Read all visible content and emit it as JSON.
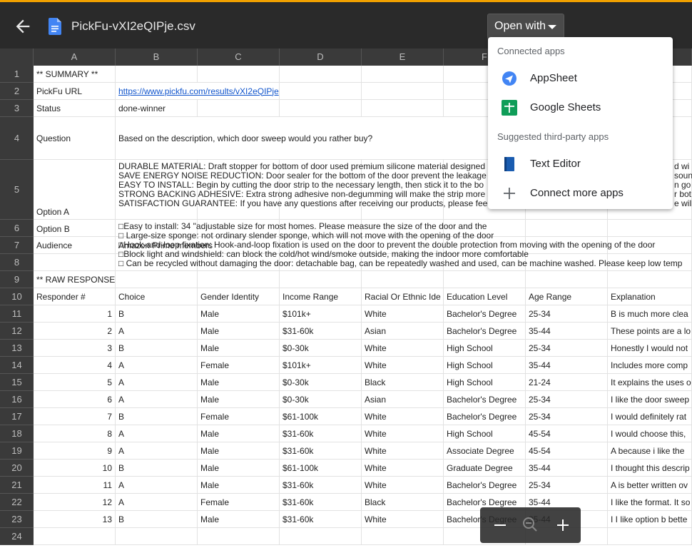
{
  "header": {
    "file_name": "PickFu-vXI2eQIPje.csv",
    "open_with_label": "Open with"
  },
  "icons": {
    "back": "arrow-left-icon",
    "file": "google-docs-file-icon",
    "appsheet": "appsheet-icon",
    "sheets": "google-sheets-icon",
    "text_editor": "text-editor-icon",
    "connect": "plus-icon",
    "zoom_out": "zoom-out-icon",
    "zoom_in": "zoom-in-icon"
  },
  "colors": {
    "topbar": "#2a2a2a",
    "accent": "#f0a000",
    "link": "#1155cc",
    "sheets_green": "#0f9d58",
    "appsheet_blue": "#4285f4"
  },
  "open_with_menu": {
    "connected_label": "Connected apps",
    "suggested_label": "Suggested third-party apps",
    "items": [
      {
        "label": "AppSheet"
      },
      {
        "label": "Google Sheets"
      },
      {
        "label": "Text Editor"
      },
      {
        "label": "Connect more apps"
      }
    ]
  },
  "sheet": {
    "columns": [
      "A",
      "B",
      "C",
      "D",
      "E",
      "F"
    ],
    "row_numbers": [
      "1",
      "2",
      "3",
      "4",
      "5",
      "6",
      "7",
      "8",
      "9",
      "10",
      "11",
      "12",
      "13",
      "14",
      "15",
      "16",
      "17",
      "18",
      "19",
      "20",
      "21",
      "22",
      "23",
      "24"
    ],
    "summary": {
      "r1": "** SUMMARY **",
      "r2_label": "PickFu URL",
      "r2_value": "https://www.pickfu.com/results/vXI2eQIPje",
      "r3_label": "Status",
      "r3_value": "done-winner",
      "r4_label": "Question",
      "r4_value": "Based on the description, which door sweep would you rather buy?",
      "r5_label": "Option A",
      "r5_value": "DURABLE MATERIAL: Draft stopper for bottom of door used premium silicone material designed\nSAVE ENERGY NOISE REDUCTION: Door sealer for the bottom of the door prevent the leakage o\nEASY TO INSTALL: Begin by cutting the door strip to the necessary length, then stick it to the bo\nSTRONG BACKING ADHESIVE: Extra strong adhesive non-degumming will make the strip more s\nSATISFACTION GUARANTEE: If you have any questions after receiving our products, please fee",
      "r5_right": "d wi\nsoun\nn go\nr bot\ne will",
      "r6_label": "Option B",
      "r6_value": "□Easy to install: 34 \"adjustable size for most homes. Please measure the size of the door and the\n□ Large-size sponge: not ordinary slender sponge, which will not move with the opening of the door\n□Hook-and-loop fixation: Hook-and-loop fixation is used on the door to prevent the double protection from moving with the opening of the door\n□Block light and windshield: can block the cold/hot wind/smoke outside, making the indoor more comfortable\n□ Can be recycled without damaging the door: detachable bag, can be repeatedly washed and used, can be machine washed. Please keep low temp",
      "r7_label": "Audience",
      "r7_value": "Amazon Prime members",
      "r9": "** RAW RESPONSES **"
    },
    "table_headers": [
      "Responder #",
      "Choice",
      "Gender Identity",
      "Income Range",
      "Racial Or Ethnic Ide",
      "Education Level",
      "Age Range",
      "Explanation"
    ],
    "rows": [
      [
        "1",
        "B",
        "Male",
        "$101k+",
        "White",
        "Bachelor's Degree",
        "25-34",
        "B is much more clea"
      ],
      [
        "2",
        "A",
        "Male",
        "$31-60k",
        "Asian",
        "Bachelor's Degree",
        "35-44",
        "These points are a lo"
      ],
      [
        "3",
        "B",
        "Male",
        "$0-30k",
        "White",
        "High School",
        "25-34",
        "Honestly I would not"
      ],
      [
        "4",
        "A",
        "Female",
        "$101k+",
        "White",
        "High School",
        "35-44",
        "Includes more comp"
      ],
      [
        "5",
        "A",
        "Male",
        "$0-30k",
        "Black",
        "High School",
        "21-24",
        "It explains the uses o"
      ],
      [
        "6",
        "A",
        "Male",
        "$0-30k",
        "Asian",
        "Bachelor's Degree",
        "25-34",
        "I like the door sweep"
      ],
      [
        "7",
        "B",
        "Female",
        "$61-100k",
        "White",
        "Bachelor's Degree",
        "25-34",
        "I would definitely rat"
      ],
      [
        "8",
        "A",
        "Male",
        "$31-60k",
        "White",
        "High School",
        "45-54",
        "I would choose this, "
      ],
      [
        "9",
        "A",
        "Male",
        "$31-60k",
        "White",
        "Associate Degree",
        "45-54",
        "A because i like the "
      ],
      [
        "10",
        "B",
        "Male",
        "$61-100k",
        "White",
        "Graduate Degree",
        "35-44",
        "I thought this descrip"
      ],
      [
        "11",
        "A",
        "Male",
        "$31-60k",
        "White",
        "Bachelor's Degree",
        "25-34",
        "A is better written ov"
      ],
      [
        "12",
        "A",
        "Female",
        "$31-60k",
        "Black",
        "Bachelor's Degree",
        "35-44",
        "I like the format. It so"
      ],
      [
        "13",
        "B",
        "Male",
        "$31-60k",
        "White",
        "Bachelor's Degree",
        "35-44",
        "I I like option b bette"
      ]
    ]
  }
}
